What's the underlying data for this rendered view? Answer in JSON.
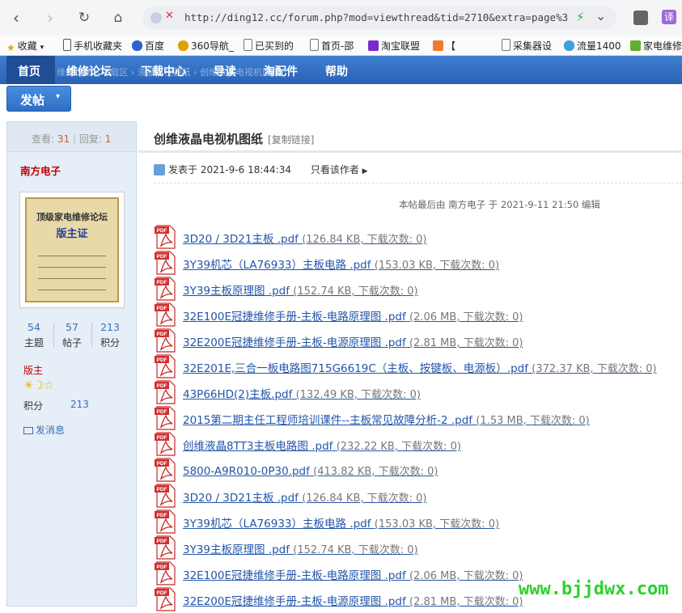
{
  "browser": {
    "url": "http://ding12.cc/forum.php?mod=viewthread&tid=2710&extra=page%3",
    "ext2_label": "译",
    "bookmarks": [
      "收藏",
      "手机收藏夹",
      "百度",
      "360导航_",
      "已买到的",
      "首页-邵",
      "淘宝联盟",
      "【",
      "采集器设",
      "流量1400",
      "家电维修"
    ]
  },
  "nav": {
    "items": [
      "首页",
      "维修论坛",
      "下载中心",
      "导读",
      "淘配件",
      "帮助"
    ],
    "ghost": "维修论坛 › 下载区 › 液晶电视图纸 › 创维液晶电视机图纸"
  },
  "post_button": {
    "label": "发帖"
  },
  "sidebar": {
    "views_label": "查看:",
    "views": "31",
    "replies_label": "回复:",
    "replies": "1",
    "author": "南方电子",
    "cert_title": "顶级家电维修论坛",
    "cert_sub": "版主证",
    "counts": [
      {
        "value": "54",
        "label": "主题"
      },
      {
        "value": "57",
        "label": "帖子"
      },
      {
        "value": "213",
        "label": "积分"
      }
    ],
    "role": "版主",
    "score_label": "积分",
    "score": "213",
    "message": "发消息"
  },
  "thread": {
    "title": "创维液晶电视机图纸",
    "copy_link": "[复制链接]",
    "posted": "发表于 2021-9-6 18:44:34",
    "only_author": "只看该作者",
    "edit_note": "本帖最后由 南方电子 于 2021-9-11 21:50 编辑"
  },
  "attachments": [
    {
      "name": "3D20 / 3D21主板 .pdf",
      "meta": "(126.84 KB, 下载次数: 0)"
    },
    {
      "name": "3Y39机芯（LA76933）主板电路 .pdf",
      "meta": "(153.03 KB, 下载次数: 0)"
    },
    {
      "name": "3Y39主板原理图 .pdf",
      "meta": "(152.74 KB, 下载次数: 0)"
    },
    {
      "name": "32E100E冠捷维修手册-主板-电路原理图 .pdf",
      "meta": "(2.06 MB, 下载次数: 0)"
    },
    {
      "name": "32E200E冠捷维修手册-主板-电源原理图 .pdf",
      "meta": "(2.81 MB, 下载次数: 0)"
    },
    {
      "name": "32E201E,三合一板电路图715G6619C（主板、按键板、电源板）.pdf",
      "meta": "(372.37 KB, 下载次数: 0)"
    },
    {
      "name": "43P66HD(2)主板.pdf",
      "meta": "(132.49 KB, 下载次数: 0)"
    },
    {
      "name": "2015第二期主任工程师培训课件--主板常见故障分析-2 .pdf",
      "meta": "(1.53 MB, 下载次数: 0)"
    },
    {
      "name": "创维液晶8TT3主板电路图 .pdf",
      "meta": "(232.22 KB, 下载次数: 0)"
    },
    {
      "name": "5800-A9R010-0P30.pdf",
      "meta": "(413.82 KB, 下载次数: 0)"
    },
    {
      "name": "3D20 / 3D21主板 .pdf",
      "meta": "(126.84 KB, 下载次数: 0)"
    },
    {
      "name": "3Y39机芯（LA76933）主板电路 .pdf",
      "meta": "(153.03 KB, 下载次数: 0)"
    },
    {
      "name": "3Y39主板原理图 .pdf",
      "meta": "(152.74 KB, 下载次数: 0)"
    },
    {
      "name": "32E100E冠捷维修手册-主板-电路原理图 .pdf",
      "meta": "(2.06 MB, 下载次数: 0)"
    },
    {
      "name": "32E200E冠捷维修手册-主板-电源原理图 .pdf",
      "meta": "(2.81 MB, 下载次数: 0)"
    }
  ],
  "watermark": "www.bjjdwx.com"
}
